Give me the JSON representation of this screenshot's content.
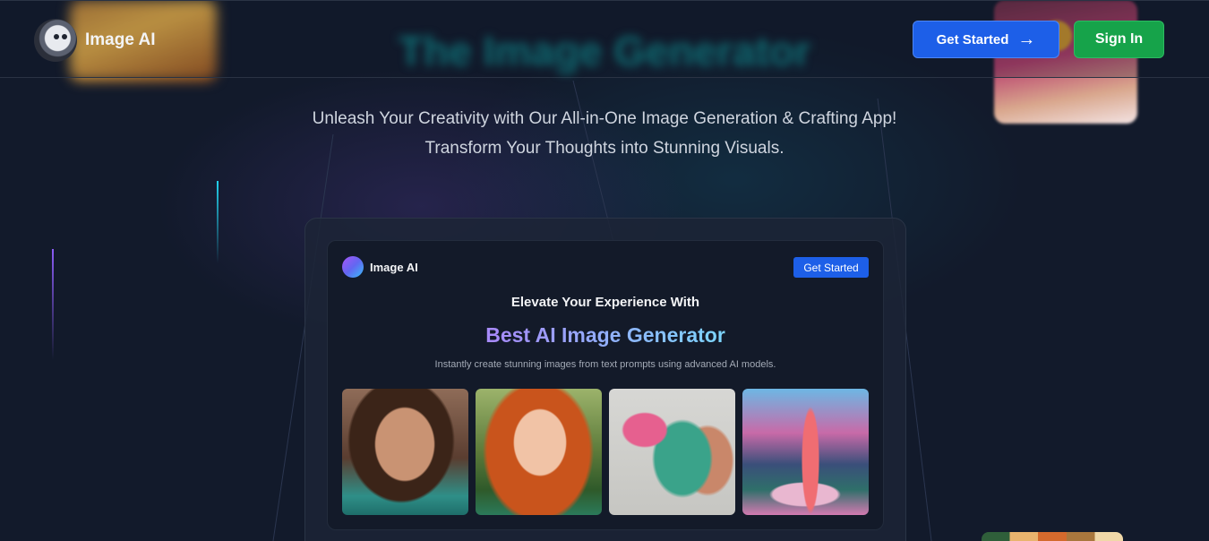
{
  "header": {
    "brand": "Image AI",
    "hero_title_blurred": "The Image Generator",
    "get_started_label": "Get Started",
    "sign_in_label": "Sign In"
  },
  "hero": {
    "tagline_line1": "Unleash Your Creativity with Our All-in-One Image Generation & Crafting App!",
    "tagline_line2": "Transform Your Thoughts into Stunning Visuals."
  },
  "preview": {
    "brand": "Image AI",
    "get_started_label": "Get Started",
    "heading": "Elevate Your Experience With",
    "title": "Best AI Image Generator",
    "description": "Instantly create stunning images from text prompts using advanced AI models.",
    "gallery": [
      {
        "name": "woman-portrait-image"
      },
      {
        "name": "redhead-portrait-image"
      },
      {
        "name": "hummingbird-image"
      },
      {
        "name": "flamingo-image"
      }
    ]
  },
  "colors": {
    "background": "#121a2b",
    "primary_button": "#1d5fe8",
    "signin_button": "#16a34a",
    "title_gradient_start": "#a78bfa",
    "title_gradient_end": "#7dd3fc"
  }
}
